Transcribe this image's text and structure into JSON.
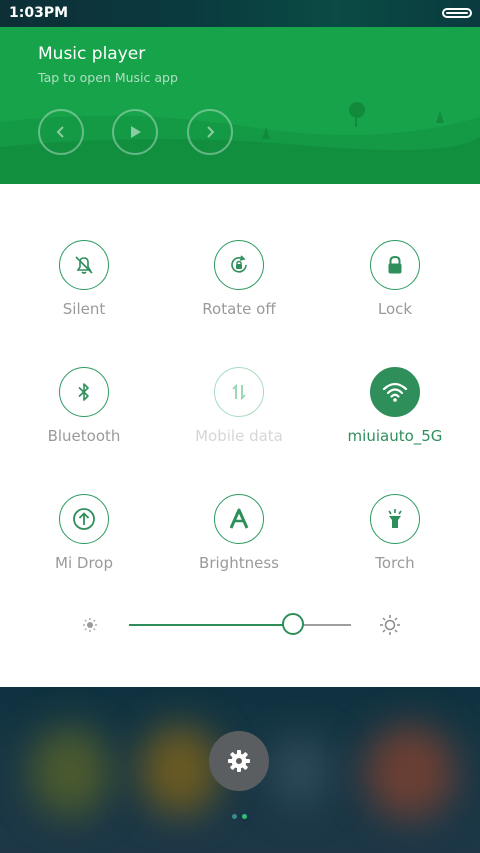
{
  "status_bar": {
    "time": "1:03PM",
    "battery_icon": "battery-icon"
  },
  "music": {
    "title": "Music player",
    "subtitle": "Tap to open Music app",
    "controls": [
      "previous-icon",
      "play-icon",
      "next-icon"
    ],
    "background_color": "#17a34a"
  },
  "toggles": [
    {
      "label": "Silent",
      "icon": "bell-off-icon",
      "state": "off"
    },
    {
      "label": "Rotate off",
      "icon": "rotate-lock-icon",
      "state": "off"
    },
    {
      "label": "Lock",
      "icon": "lock-icon",
      "state": "off"
    },
    {
      "label": "Bluetooth",
      "icon": "bluetooth-icon",
      "state": "off"
    },
    {
      "label": "Mobile data",
      "icon": "mobile-data-icon",
      "state": "disabled"
    },
    {
      "label": "miuiauto_5G",
      "icon": "wifi-icon",
      "state": "on"
    },
    {
      "label": "Mi Drop",
      "icon": "mi-drop-icon",
      "state": "off"
    },
    {
      "label": "Brightness",
      "icon": "auto-brightness-icon",
      "state": "off"
    },
    {
      "label": "Torch",
      "icon": "torch-icon",
      "state": "off"
    }
  ],
  "brightness": {
    "level": 0.74,
    "min_icon": "brightness-low-icon",
    "max_icon": "brightness-high-icon"
  },
  "bottom": {
    "settings_icon": "gear-icon",
    "pages": 2,
    "active_page": 1
  },
  "colors": {
    "accent": "#2e8f5b",
    "inactive_text": "#9a9a9a",
    "disabled_text": "#d6d6d6"
  }
}
